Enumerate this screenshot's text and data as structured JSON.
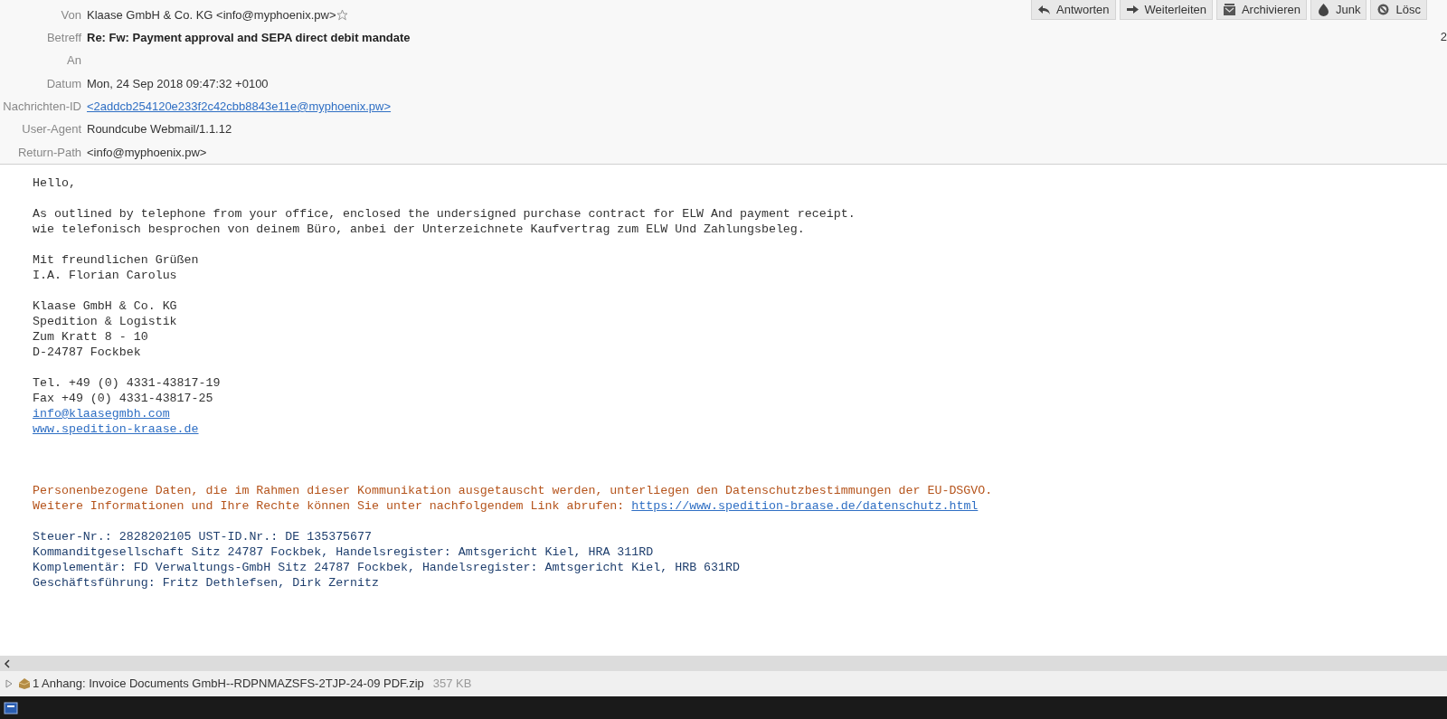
{
  "header": {
    "fields": [
      {
        "label": "Von",
        "value": "Klaase GmbH & Co. KG <info@myphoenix.pw>",
        "kind": "sender"
      },
      {
        "label": "Betreff",
        "value": "Re: Fw: Payment approval and SEPA direct debit mandate",
        "kind": "subject"
      },
      {
        "label": "An",
        "kind": "plain"
      },
      {
        "label": "Datum",
        "value": "Mon, 24 Sep 2018 09:47:32 +0100",
        "kind": "plain"
      },
      {
        "label": "Nachrichten-ID",
        "value": "<2addcb254120e233f2c42cbb8843e11e@myphoenix.pw>",
        "kind": "link"
      },
      {
        "label": "User-Agent",
        "value": "Roundcube Webmail/1.1.12",
        "kind": "plain"
      },
      {
        "label": "Return-Path",
        "value": "<info@myphoenix.pw>",
        "kind": "plain"
      }
    ],
    "toolbar": [
      {
        "label": "Antworten",
        "kind": "reply"
      },
      {
        "label": "Weiterleiten",
        "kind": "forward"
      },
      {
        "label": "Archivieren",
        "kind": "archive"
      },
      {
        "label": "Junk",
        "kind": "junk"
      },
      {
        "label": "Lösc",
        "kind": "delete"
      }
    ],
    "date_fragment": "2"
  },
  "body": {
    "blocks": [
      {
        "kind": "plain",
        "lines": [
          {
            "text": "Hello,"
          }
        ]
      },
      {
        "kind": "plain",
        "lines": [
          {
            "text": "As outlined by telephone from your office, enclosed the undersigned purchase contract for ELW And payment receipt."
          },
          {
            "text": "wie telefonisch besprochen von deinem Büro, anbei der Unterzeichnete Kaufvertrag zum ELW Und Zahlungsbeleg."
          }
        ]
      },
      {
        "kind": "plain",
        "lines": [
          {
            "text": "Mit freundlichen Grüßen"
          },
          {
            "text": "I.A. Florian Carolus"
          }
        ]
      },
      {
        "kind": "plain",
        "lines": [
          {
            "text": "Klaase GmbH & Co. KG"
          },
          {
            "text": "Spedition & Logistik"
          },
          {
            "text": "Zum Kratt 8 - 10"
          },
          {
            "text": "D-24787 Fockbek"
          }
        ]
      },
      {
        "kind": "plain",
        "lines": [
          {
            "text": "Tel. +49 (0) 4331-43817-19"
          },
          {
            "text": "Fax +49 (0) 4331-43817-25"
          },
          {
            "link": "info@klaasegmbh.com"
          },
          {
            "link": "www.spedition-kraase.de"
          }
        ]
      },
      {
        "kind": "notice",
        "lines": [
          {
            "text": "Personenbezogene Daten, die im Rahmen dieser Kommunikation ausgetauscht werden, unterliegen den Datenschutzbestimmungen der EU-DSGVO."
          },
          {
            "text": "Weitere Informationen und Ihre Rechte können Sie unter nachfolgendem Link abrufen:",
            "link": "https://www.spedition-braase.de/datenschutz.html"
          }
        ]
      },
      {
        "kind": "legal",
        "lines": [
          {
            "text": "Steuer-Nr.: 2828202105 UST-ID.Nr.: DE 135375677"
          },
          {
            "text": "Kommanditgesellschaft Sitz 24787 Fockbek, Handelsregister: Amtsgericht Kiel, HRA 311RD"
          },
          {
            "text": "Komplementär: FD Verwaltungs-GmbH Sitz 24787 Fockbek, Handelsregister: Amtsgericht Kiel, HRB 631RD"
          },
          {
            "text": "Geschäftsführung: Fritz Dethlefsen, Dirk Zernitz"
          }
        ]
      }
    ]
  },
  "attachment": {
    "label": "1 Anhang: Invoice Documents GmbH--RDPNMAZSFS-2TJP-24-09 PDF.zip",
    "size": "357 KB",
    "expanded": false
  }
}
